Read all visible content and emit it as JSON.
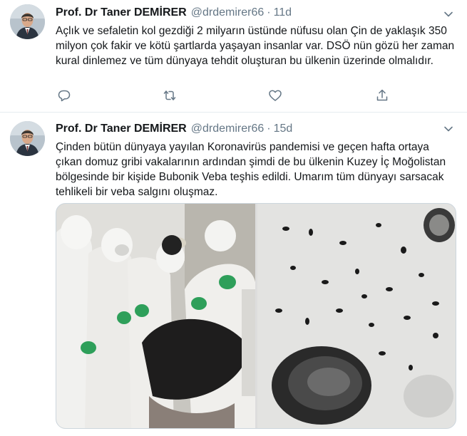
{
  "tweets": [
    {
      "author_name": "Prof. Dr Taner DEMİRER",
      "handle": "@drdemirer66",
      "separator": "·",
      "time": "11d",
      "text": "Açlık ve sefaletin kol gezdiği 2 milyarın üstünde nüfusu olan Çin de yaklaşık 350 milyon çok fakir ve kötü şartlarda yaşayan insanlar var. DSÖ nün gözü her zaman kural dinlemez ve tüm dünyaya tehdit oluşturan bu ülkenin üzerinde olmalıdır.",
      "actions": [
        "reply-icon",
        "retweet-icon",
        "like-icon",
        "share-icon"
      ]
    },
    {
      "author_name": "Prof. Dr Taner DEMİRER",
      "handle": "@drdemirer66",
      "separator": "·",
      "time": "15d",
      "text": "Çinden bütün dünyaya yayılan Koronavirüs pandemisi ve geçen hafta ortaya çıkan domuz gribi vakalarının ardından şimdi de bu ülkenin Kuzey İç Moğolistan bölgesinde bir kişide Bubonik Veba teşhis edildi. Umarım tüm dünyayı sarsacak tehlikeli bir veba salgını oluşmaz.",
      "media": [
        "photo-protective-suits",
        "photo-microscope-bacteria"
      ]
    }
  ],
  "colors": {
    "text_primary": "#14171a",
    "text_secondary": "#657786",
    "divider": "#e6ecf0",
    "suit_green_gloves": "#2e9f5a"
  }
}
